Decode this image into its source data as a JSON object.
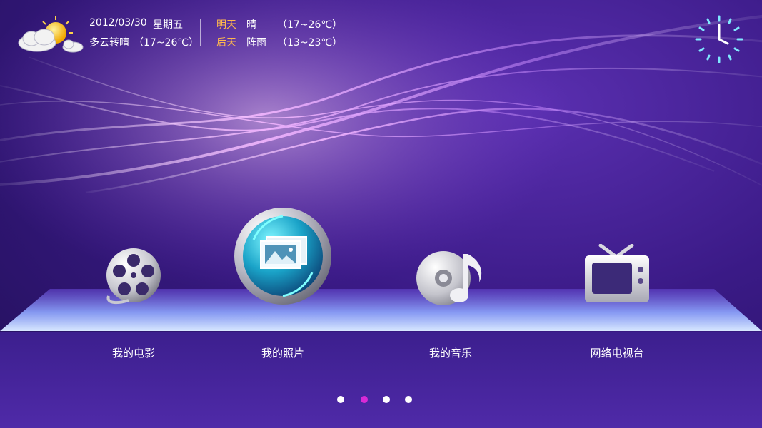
{
  "weather": {
    "date": "2012/03/30",
    "weekday": "星期五",
    "today_forecast": "多云转晴",
    "today_temp": "（17~26℃）",
    "tomorrow_label": "明天",
    "tomorrow_condition": "晴",
    "tomorrow_temp": "（17~26℃）",
    "day_after_label": "后天",
    "day_after_condition": "阵雨",
    "day_after_temp": "（13~23℃）",
    "icon": "partly-cloudy-icon"
  },
  "clock": {
    "icon": "clock-icon"
  },
  "menu": {
    "items": [
      {
        "label": "我的电影",
        "icon": "film-reel-icon"
      },
      {
        "label": "我的照片",
        "icon": "photos-icon"
      },
      {
        "label": "我的音乐",
        "icon": "music-disc-icon"
      },
      {
        "label": "网络电视台",
        "icon": "tv-icon"
      }
    ],
    "selected_index": 1
  },
  "pagination": {
    "page_count": 4,
    "current_page": 2
  },
  "colors": {
    "accent": "#ffb84d",
    "active_dot": "#d92ad6",
    "background": "#3a1a86"
  }
}
